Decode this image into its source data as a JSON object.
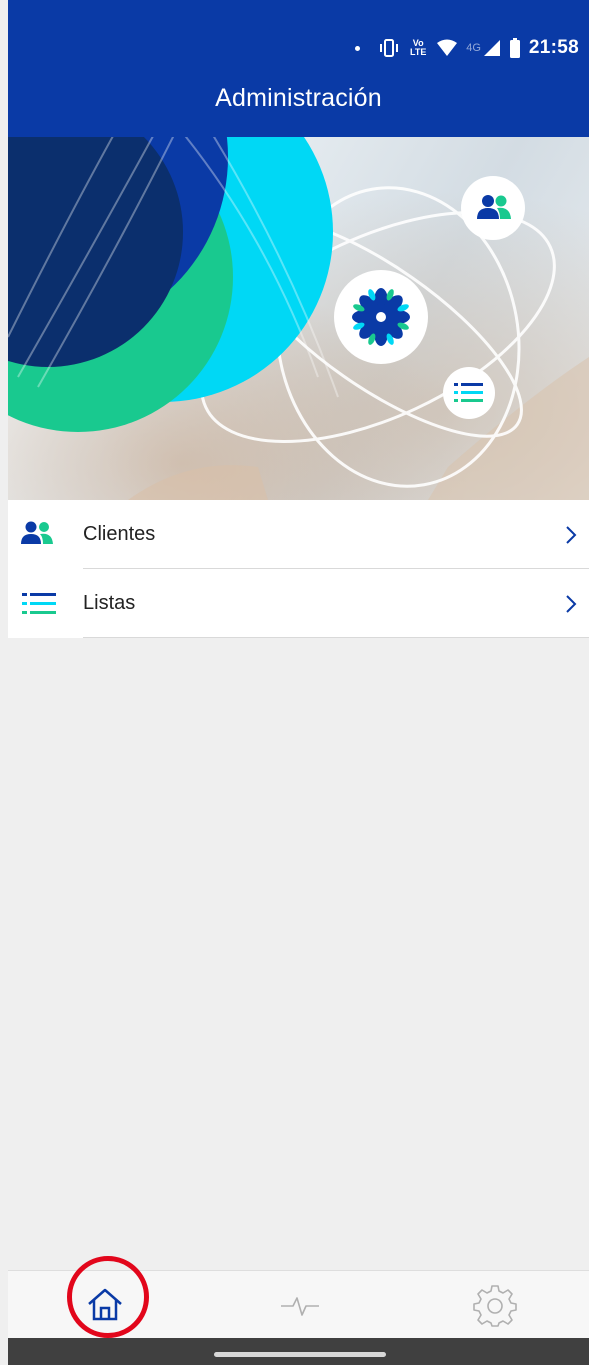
{
  "status_bar": {
    "time": "21:58",
    "network": "4G",
    "volte": "Vo LTE"
  },
  "header": {
    "title": "Administración"
  },
  "hero": {
    "icons": [
      "users-icon",
      "flower-logo-icon",
      "list-icon"
    ]
  },
  "menu": {
    "items": [
      {
        "label": "Clientes",
        "icon": "users-icon"
      },
      {
        "label": "Listas",
        "icon": "list-icon"
      }
    ]
  },
  "bottom_nav": {
    "items": [
      {
        "icon": "home-icon",
        "active": true
      },
      {
        "icon": "activity-icon",
        "active": false
      },
      {
        "icon": "gear-icon",
        "active": false
      }
    ]
  },
  "colors": {
    "primary": "#0a3aa6",
    "accent_green": "#19c98f",
    "accent_cyan": "#00d8f5",
    "highlight_ring": "#e2061b"
  }
}
